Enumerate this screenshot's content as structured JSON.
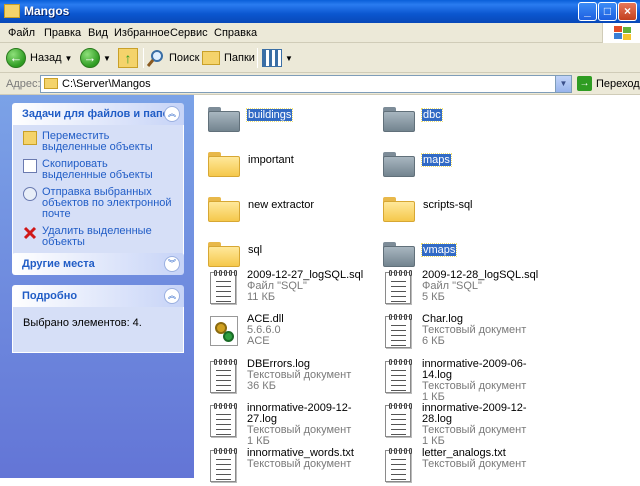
{
  "window": {
    "title": "Mangos",
    "min_label": "_",
    "max_label": "□",
    "close_label": "×"
  },
  "menu": {
    "items": [
      "Файл",
      "Правка",
      "Вид",
      "Избранное",
      "Сервис",
      "Справка"
    ]
  },
  "toolbar": {
    "back_label": "Назад",
    "back_glyph": "←",
    "forward_glyph": "→",
    "up_glyph": "↑",
    "search_label": "Поиск",
    "folders_label": "Папки",
    "dropdown_glyph": "▼"
  },
  "address": {
    "label": "Адрес:",
    "value": "C:\\Server\\Mangos",
    "go_label": "Переход",
    "go_glyph": "→"
  },
  "left": {
    "tasks": {
      "title": "Задачи для файлов и папок",
      "items": [
        {
          "label": "Переместить выделенные объекты",
          "icon": "move-icon"
        },
        {
          "label": "Скопировать выделенные объекты",
          "icon": "copy-icon"
        },
        {
          "label": "Отправка выбранных объектов по электронной почте",
          "icon": "email-icon"
        },
        {
          "label": "Удалить выделенные объекты",
          "icon": "delete-icon"
        }
      ]
    },
    "other_places": {
      "title": "Другие места"
    },
    "details": {
      "title": "Подробно",
      "text": "Выбрано элементов: 4."
    },
    "chevron_up": "︽",
    "chevron_down": "︾"
  },
  "files": [
    {
      "name": "buildings",
      "type": "folder",
      "color": "gray",
      "selected": true
    },
    {
      "name": "dbc",
      "type": "folder",
      "color": "gray",
      "selected": true
    },
    {
      "name": "important",
      "type": "folder",
      "color": "yellow",
      "selected": false
    },
    {
      "name": "maps",
      "type": "folder",
      "color": "gray",
      "selected": true
    },
    {
      "name": "new extractor",
      "type": "folder",
      "color": "yellow",
      "selected": false
    },
    {
      "name": "scripts-sql",
      "type": "folder",
      "color": "yellow",
      "selected": false
    },
    {
      "name": "sql",
      "type": "folder",
      "color": "yellow",
      "selected": false
    },
    {
      "name": "vmaps",
      "type": "folder",
      "color": "gray",
      "selected": true
    },
    {
      "name": "2009-12-27_logSQL.sql",
      "type": "doc",
      "line2": "Файл \"SQL\"",
      "line3": "11 КБ"
    },
    {
      "name": "2009-12-28_logSQL.sql",
      "type": "doc",
      "line2": "Файл \"SQL\"",
      "line3": "5 КБ"
    },
    {
      "name": "ACE.dll",
      "type": "dll",
      "line2": "5.6.6.0",
      "line3": "ACE"
    },
    {
      "name": "Char.log",
      "type": "doc",
      "line2": "Текстовый документ",
      "line3": "6 КБ"
    },
    {
      "name": "DBErrors.log",
      "type": "doc",
      "line2": "Текстовый документ",
      "line3": "36 КБ"
    },
    {
      "name": "innormative-2009-06-14.log",
      "type": "doc",
      "line2": "Текстовый документ",
      "line3": "1 КБ"
    },
    {
      "name": "innormative-2009-12-27.log",
      "type": "doc",
      "line2": "Текстовый документ",
      "line3": "1 КБ"
    },
    {
      "name": "innormative-2009-12-28.log",
      "type": "doc",
      "line2": "Текстовый документ",
      "line3": "1 КБ"
    },
    {
      "name": "innormative_words.txt",
      "type": "doc",
      "line2": "Текстовый документ",
      "line3": ""
    },
    {
      "name": "letter_analogs.txt",
      "type": "doc",
      "line2": "Текстовый документ",
      "line3": ""
    }
  ]
}
